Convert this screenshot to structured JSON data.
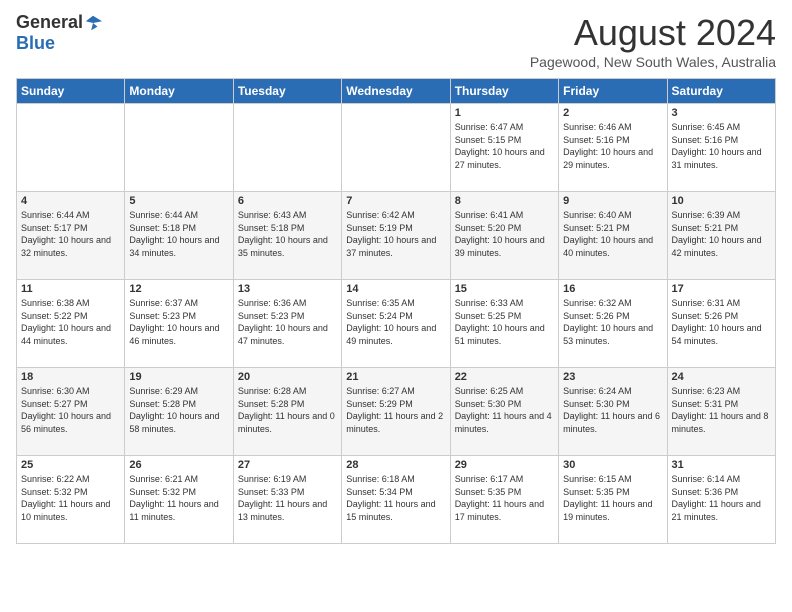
{
  "header": {
    "logo_general": "General",
    "logo_blue": "Blue",
    "month_title": "August 2024",
    "location": "Pagewood, New South Wales, Australia"
  },
  "days_of_week": [
    "Sunday",
    "Monday",
    "Tuesday",
    "Wednesday",
    "Thursday",
    "Friday",
    "Saturday"
  ],
  "weeks": [
    [
      {
        "day": "",
        "info": ""
      },
      {
        "day": "",
        "info": ""
      },
      {
        "day": "",
        "info": ""
      },
      {
        "day": "",
        "info": ""
      },
      {
        "day": "1",
        "info": "Sunrise: 6:47 AM\nSunset: 5:15 PM\nDaylight: 10 hours\nand 27 minutes."
      },
      {
        "day": "2",
        "info": "Sunrise: 6:46 AM\nSunset: 5:16 PM\nDaylight: 10 hours\nand 29 minutes."
      },
      {
        "day": "3",
        "info": "Sunrise: 6:45 AM\nSunset: 5:16 PM\nDaylight: 10 hours\nand 31 minutes."
      }
    ],
    [
      {
        "day": "4",
        "info": "Sunrise: 6:44 AM\nSunset: 5:17 PM\nDaylight: 10 hours\nand 32 minutes."
      },
      {
        "day": "5",
        "info": "Sunrise: 6:44 AM\nSunset: 5:18 PM\nDaylight: 10 hours\nand 34 minutes."
      },
      {
        "day": "6",
        "info": "Sunrise: 6:43 AM\nSunset: 5:18 PM\nDaylight: 10 hours\nand 35 minutes."
      },
      {
        "day": "7",
        "info": "Sunrise: 6:42 AM\nSunset: 5:19 PM\nDaylight: 10 hours\nand 37 minutes."
      },
      {
        "day": "8",
        "info": "Sunrise: 6:41 AM\nSunset: 5:20 PM\nDaylight: 10 hours\nand 39 minutes."
      },
      {
        "day": "9",
        "info": "Sunrise: 6:40 AM\nSunset: 5:21 PM\nDaylight: 10 hours\nand 40 minutes."
      },
      {
        "day": "10",
        "info": "Sunrise: 6:39 AM\nSunset: 5:21 PM\nDaylight: 10 hours\nand 42 minutes."
      }
    ],
    [
      {
        "day": "11",
        "info": "Sunrise: 6:38 AM\nSunset: 5:22 PM\nDaylight: 10 hours\nand 44 minutes."
      },
      {
        "day": "12",
        "info": "Sunrise: 6:37 AM\nSunset: 5:23 PM\nDaylight: 10 hours\nand 46 minutes."
      },
      {
        "day": "13",
        "info": "Sunrise: 6:36 AM\nSunset: 5:23 PM\nDaylight: 10 hours\nand 47 minutes."
      },
      {
        "day": "14",
        "info": "Sunrise: 6:35 AM\nSunset: 5:24 PM\nDaylight: 10 hours\nand 49 minutes."
      },
      {
        "day": "15",
        "info": "Sunrise: 6:33 AM\nSunset: 5:25 PM\nDaylight: 10 hours\nand 51 minutes."
      },
      {
        "day": "16",
        "info": "Sunrise: 6:32 AM\nSunset: 5:26 PM\nDaylight: 10 hours\nand 53 minutes."
      },
      {
        "day": "17",
        "info": "Sunrise: 6:31 AM\nSunset: 5:26 PM\nDaylight: 10 hours\nand 54 minutes."
      }
    ],
    [
      {
        "day": "18",
        "info": "Sunrise: 6:30 AM\nSunset: 5:27 PM\nDaylight: 10 hours\nand 56 minutes."
      },
      {
        "day": "19",
        "info": "Sunrise: 6:29 AM\nSunset: 5:28 PM\nDaylight: 10 hours\nand 58 minutes."
      },
      {
        "day": "20",
        "info": "Sunrise: 6:28 AM\nSunset: 5:28 PM\nDaylight: 11 hours\nand 0 minutes."
      },
      {
        "day": "21",
        "info": "Sunrise: 6:27 AM\nSunset: 5:29 PM\nDaylight: 11 hours\nand 2 minutes."
      },
      {
        "day": "22",
        "info": "Sunrise: 6:25 AM\nSunset: 5:30 PM\nDaylight: 11 hours\nand 4 minutes."
      },
      {
        "day": "23",
        "info": "Sunrise: 6:24 AM\nSunset: 5:30 PM\nDaylight: 11 hours\nand 6 minutes."
      },
      {
        "day": "24",
        "info": "Sunrise: 6:23 AM\nSunset: 5:31 PM\nDaylight: 11 hours\nand 8 minutes."
      }
    ],
    [
      {
        "day": "25",
        "info": "Sunrise: 6:22 AM\nSunset: 5:32 PM\nDaylight: 11 hours\nand 10 minutes."
      },
      {
        "day": "26",
        "info": "Sunrise: 6:21 AM\nSunset: 5:32 PM\nDaylight: 11 hours\nand 11 minutes."
      },
      {
        "day": "27",
        "info": "Sunrise: 6:19 AM\nSunset: 5:33 PM\nDaylight: 11 hours\nand 13 minutes."
      },
      {
        "day": "28",
        "info": "Sunrise: 6:18 AM\nSunset: 5:34 PM\nDaylight: 11 hours\nand 15 minutes."
      },
      {
        "day": "29",
        "info": "Sunrise: 6:17 AM\nSunset: 5:35 PM\nDaylight: 11 hours\nand 17 minutes."
      },
      {
        "day": "30",
        "info": "Sunrise: 6:15 AM\nSunset: 5:35 PM\nDaylight: 11 hours\nand 19 minutes."
      },
      {
        "day": "31",
        "info": "Sunrise: 6:14 AM\nSunset: 5:36 PM\nDaylight: 11 hours\nand 21 minutes."
      }
    ]
  ]
}
